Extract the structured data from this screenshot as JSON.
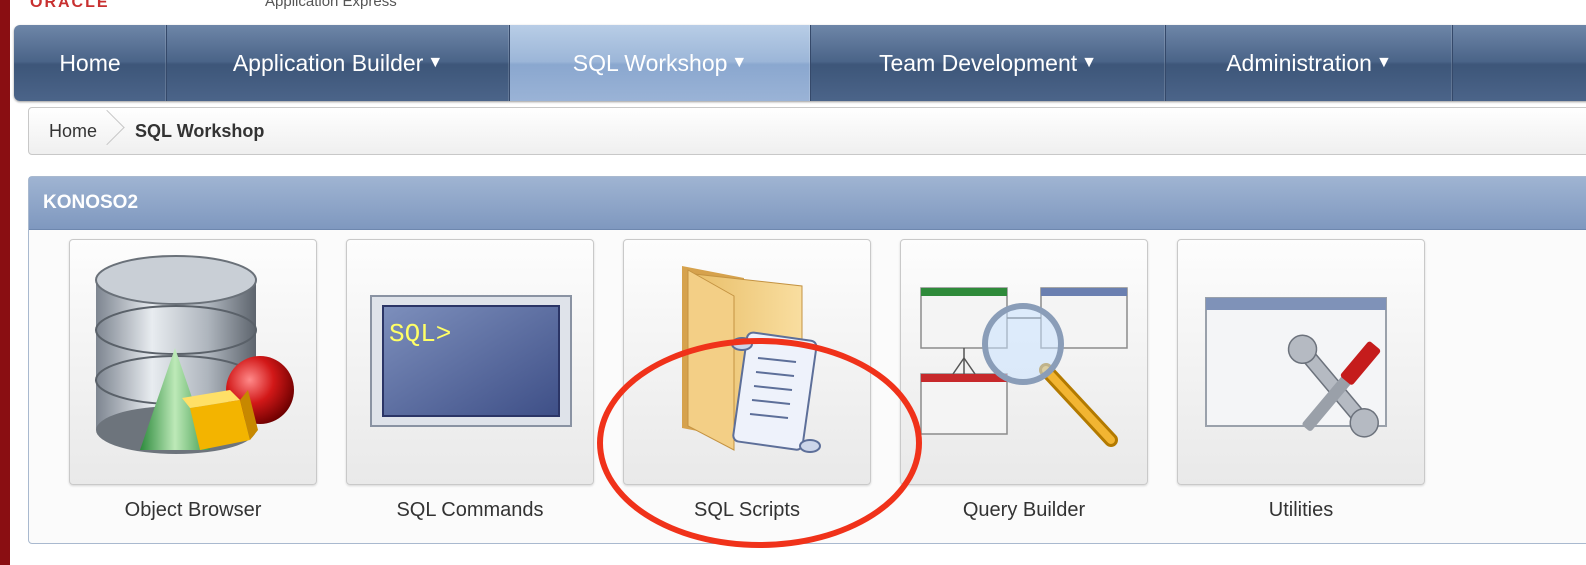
{
  "nav": {
    "tabs": [
      {
        "label": "Home",
        "has_menu": false
      },
      {
        "label": "Application Builder",
        "has_menu": true
      },
      {
        "label": "SQL Workshop",
        "has_menu": true,
        "active": true
      },
      {
        "label": "Team Development",
        "has_menu": true
      },
      {
        "label": "Administration",
        "has_menu": true
      }
    ],
    "caret": "▼"
  },
  "breadcrumb": {
    "home": "Home",
    "current": "SQL Workshop"
  },
  "region": {
    "title": "KONOSO2",
    "tiles": [
      {
        "label": "Object Browser",
        "icon": "database-objects-icon"
      },
      {
        "label": "SQL Commands",
        "icon": "sql-prompt-icon"
      },
      {
        "label": "SQL Scripts",
        "icon": "folder-script-icon"
      },
      {
        "label": "Query Builder",
        "icon": "query-builder-magnifier-icon"
      },
      {
        "label": "Utilities",
        "icon": "utilities-tools-icon"
      }
    ]
  },
  "icon_text": {
    "sql_prompt": "SQL>"
  },
  "colors": {
    "frame": "#8a0e12",
    "nav_bg": "#4a6488",
    "nav_active": "#9cb6d8",
    "region_header": "#8aa2c7",
    "highlight": "#f0321a"
  }
}
